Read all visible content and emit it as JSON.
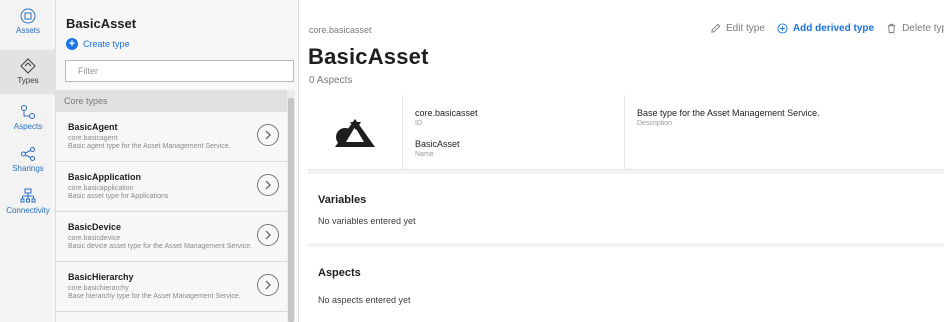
{
  "rail": {
    "items": [
      {
        "label": "Assets",
        "icon": "assets-icon"
      },
      {
        "label": "Types",
        "icon": "types-icon"
      },
      {
        "label": "Aspects",
        "icon": "aspects-icon"
      },
      {
        "label": "Sharings",
        "icon": "sharings-icon"
      },
      {
        "label": "Connectivity",
        "icon": "connectivity-icon"
      }
    ]
  },
  "panel": {
    "title": "BasicAsset",
    "create_label": "Create type",
    "filter_placeholder": "Filter",
    "group_label": "Core types",
    "items": [
      {
        "title": "BasicAgent",
        "id": "core.basicagent",
        "description": "Basic agent type for the Asset Management Service."
      },
      {
        "title": "BasicApplication",
        "id": "core.basicapplication",
        "description": "Basic asset type for Applications"
      },
      {
        "title": "BasicDevice",
        "id": "core.basicdevice",
        "description": "Basic device asset type for the Asset Management Service."
      },
      {
        "title": "BasicHierarchy",
        "id": "core.basichierarchy",
        "description": "Base hierarchy type for the Asset Management Service."
      }
    ]
  },
  "main": {
    "breadcrumb": "core.basicasset",
    "title": "BasicAsset",
    "aspect_count": "0 Aspects",
    "actions": {
      "edit": "Edit type",
      "add": "Add derived type",
      "delete": "Delete type"
    },
    "info": {
      "id_value": "core.basicasset",
      "id_caption": "ID",
      "name_value": "BasicAsset",
      "name_caption": "Name",
      "description_value": "Base type for the Asset Management Service.",
      "description_caption": "Description"
    },
    "variables": {
      "heading": "Variables",
      "empty": "No variables entered yet"
    },
    "aspects": {
      "heading": "Aspects",
      "empty": "No aspects entered yet"
    }
  },
  "colors": {
    "accent": "#1a73e8",
    "rail_bg": "#f3f3f3",
    "panel_bg": "#f7f7f7"
  }
}
